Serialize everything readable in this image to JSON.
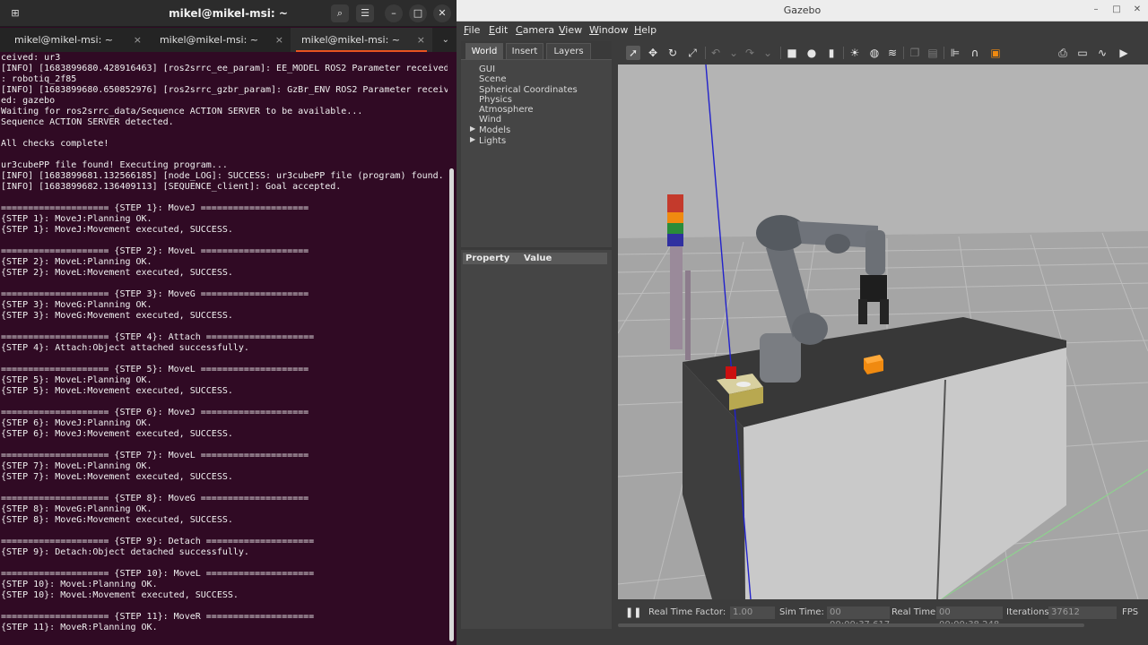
{
  "terminal": {
    "title": "mikel@mikel-msi: ~",
    "tabs": [
      {
        "label": "mikel@mikel-msi: ~"
      },
      {
        "label": "mikel@mikel-msi: ~"
      },
      {
        "label": "mikel@mikel-msi: ~"
      }
    ],
    "close_glyph": "×",
    "lines": [
      "ceived: ur3",
      "[INFO] [1683899680.428916463] [ros2srrc_ee_param]: EE_MODEL ROS2 Parameter received",
      ": robotiq_2f85",
      "[INFO] [1683899680.650852976] [ros2srrc_gzbr_param]: GzBr_ENV ROS2 Parameter receiv",
      "ed: gazebo",
      "Waiting for ros2srrc_data/Sequence ACTION SERVER to be available...",
      "Sequence ACTION SERVER detected.",
      "",
      "All checks complete!",
      "",
      "ur3cubePP file found! Executing program...",
      "[INFO] [1683899681.132566185] [node_LOG]: SUCCESS: ur3cubePP file (program) found.",
      "[INFO] [1683899682.136409113] [SEQUENCE_client]: Goal accepted.",
      "",
      "==================== {STEP 1}: MoveJ ====================",
      "{STEP 1}: MoveJ:Planning OK.",
      "{STEP 1}: MoveJ:Movement executed, SUCCESS.",
      "",
      "==================== {STEP 2}: MoveL ====================",
      "{STEP 2}: MoveL:Planning OK.",
      "{STEP 2}: MoveL:Movement executed, SUCCESS.",
      "",
      "==================== {STEP 3}: MoveG ====================",
      "{STEP 3}: MoveG:Planning OK.",
      "{STEP 3}: MoveG:Movement executed, SUCCESS.",
      "",
      "==================== {STEP 4}: Attach ====================",
      "{STEP 4}: Attach:Object attached successfully.",
      "",
      "==================== {STEP 5}: MoveL ====================",
      "{STEP 5}: MoveL:Planning OK.",
      "{STEP 5}: MoveL:Movement executed, SUCCESS.",
      "",
      "==================== {STEP 6}: MoveJ ====================",
      "{STEP 6}: MoveJ:Planning OK.",
      "{STEP 6}: MoveJ:Movement executed, SUCCESS.",
      "",
      "==================== {STEP 7}: MoveL ====================",
      "{STEP 7}: MoveL:Planning OK.",
      "{STEP 7}: MoveL:Movement executed, SUCCESS.",
      "",
      "==================== {STEP 8}: MoveG ====================",
      "{STEP 8}: MoveG:Planning OK.",
      "{STEP 8}: MoveG:Movement executed, SUCCESS.",
      "",
      "==================== {STEP 9}: Detach ====================",
      "{STEP 9}: Detach:Object detached successfully.",
      "",
      "==================== {STEP 10}: MoveL ====================",
      "{STEP 10}: MoveL:Planning OK.",
      "{STEP 10}: MoveL:Movement executed, SUCCESS.",
      "",
      "==================== {STEP 11}: MoveR ====================",
      "{STEP 11}: MoveR:Planning OK."
    ]
  },
  "gazebo": {
    "title": "Gazebo",
    "menu": [
      {
        "label": "File",
        "u": "F",
        "rest": "ile"
      },
      {
        "label": "Edit",
        "u": "E",
        "rest": "dit"
      },
      {
        "label": "Camera",
        "u": "C",
        "rest": "amera"
      },
      {
        "label": "View",
        "u": "V",
        "rest": "iew"
      },
      {
        "label": "Window",
        "u": "W",
        "rest": "indow"
      },
      {
        "label": "Help",
        "u": "H",
        "rest": "elp"
      }
    ],
    "panel_tabs": [
      "World",
      "Insert",
      "Layers"
    ],
    "tree": [
      "GUI",
      "Scene",
      "Spherical Coordinates",
      "Physics",
      "Atmosphere",
      "Wind",
      "Models",
      "Lights"
    ],
    "property_header": {
      "property": "Property",
      "value": "Value"
    },
    "status": {
      "rtf_label": "Real Time Factor:",
      "rtf_value": "1.00",
      "sim_label": "Sim Time:",
      "sim_value": "00 00:00:37.617",
      "real_label": "Real Time:",
      "real_value": "00 00:00:38.248",
      "iter_label": "Iterations:",
      "iter_value": "37612",
      "fps_label": "FPS"
    },
    "colors": {
      "terminal_bg": "#300a24",
      "accent": "#e95420",
      "viewport_sky": "#b5b5b5",
      "ground": "#a3a3a3",
      "cabinet": "#c8c8c8",
      "tabletop": "#353535",
      "cube": "#f08a10"
    }
  }
}
